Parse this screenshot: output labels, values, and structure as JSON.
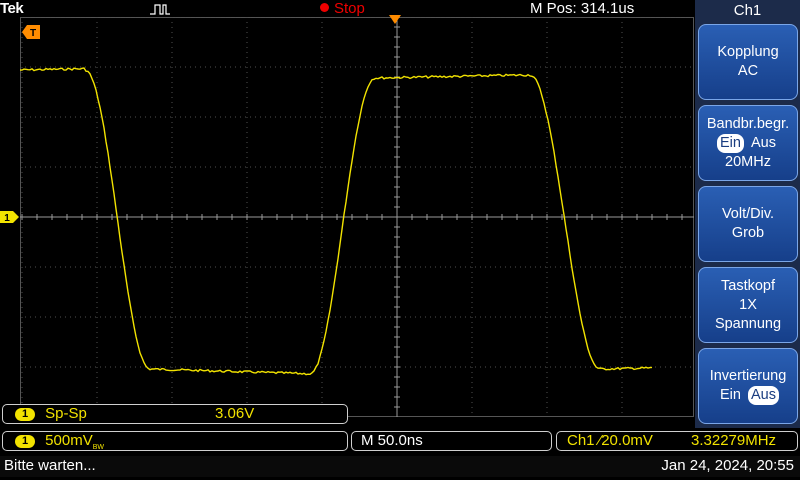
{
  "header": {
    "brand": "Tek",
    "run_state": "Stop",
    "main_position": "M Pos: 314.1us"
  },
  "side_menu": {
    "title": "Ch1",
    "buttons": [
      {
        "line1": "Kopplung",
        "line2": "AC"
      },
      {
        "line1": "Bandbr.begr.",
        "opt1": "Ein",
        "opt2": "Aus",
        "line3": "20MHz"
      },
      {
        "line1": "Volt/Div.",
        "line2": "Grob"
      },
      {
        "line1": "Tastkopf",
        "line2": "1X",
        "line3": "Spannung"
      },
      {
        "line1": "Invertierung",
        "opt1": "Ein",
        "opt2": "Aus"
      }
    ]
  },
  "measurement": {
    "channel": "1",
    "label": "Sp-Sp",
    "value": "3.06V"
  },
  "bottom": {
    "ch_badge": "1",
    "vdiv": "500mV",
    "bw_sub": "BW",
    "timebase": "M 50.0ns",
    "trigger_source": "Ch1",
    "trigger_slope": "⁄",
    "trigger_level": "20.0mV",
    "frequency": "3.32279MHz"
  },
  "status": {
    "message": "Bitte warten...",
    "datetime": "Jan 24, 2024, 20:55"
  },
  "markers": {
    "ch1_marker": "1",
    "trigger_level_marker": "T"
  },
  "colors": {
    "trace": "#f2e300",
    "run_state": "#e00000",
    "menu_bg": "#1c2b4a",
    "button_bg": "#2a5fb4"
  }
}
